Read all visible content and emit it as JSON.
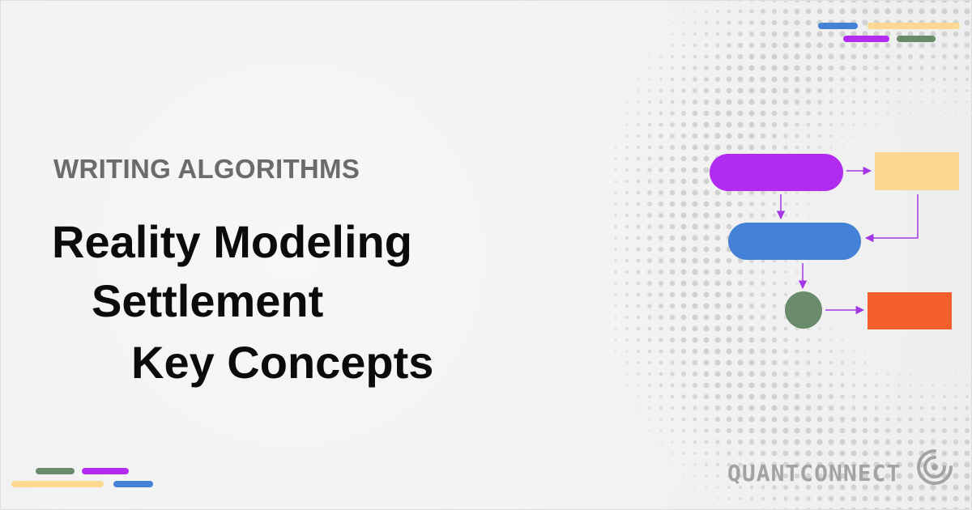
{
  "header": {
    "section_label": "WRITING ALGORITHMS"
  },
  "title": {
    "line1": "Reality Modeling",
    "line2": "Settlement",
    "line3": "Key Concepts"
  },
  "brand": {
    "name": "QUANTCONNECT",
    "logo_icon": "quantconnect-logo-icon"
  },
  "colors": {
    "purple": "#b12cf0",
    "blue": "#4581d6",
    "yellow": "#fdd892",
    "green": "#6a8b6b",
    "orange": "#f55f2c",
    "arrow": "#a437e6",
    "dots": "#c9c9c9"
  },
  "flowchart": {
    "nodes": [
      "purple-pill-node",
      "yellow-rect-node",
      "blue-pill-node",
      "green-circle-node",
      "orange-rect-node"
    ]
  }
}
